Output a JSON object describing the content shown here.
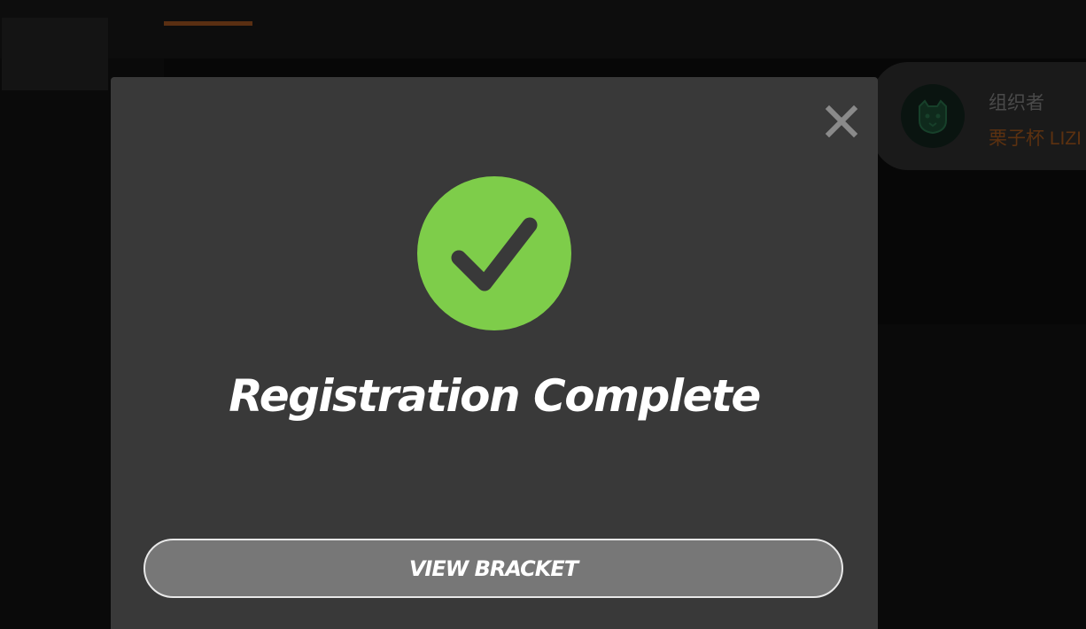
{
  "background": {
    "organizer": {
      "label": "组织者",
      "name": "栗子杯 LIZI",
      "avatar_icon": "tiger-head-icon"
    }
  },
  "modal": {
    "title": "Registration Complete",
    "status_icon": "check-circle-icon",
    "close_icon": "close-icon",
    "primary_button_label": "VIEW BRACKET"
  },
  "colors": {
    "success_green": "#7ecd4a",
    "modal_bg": "#393939",
    "button_bg": "#777777",
    "accent_orange": "#5c3110"
  }
}
